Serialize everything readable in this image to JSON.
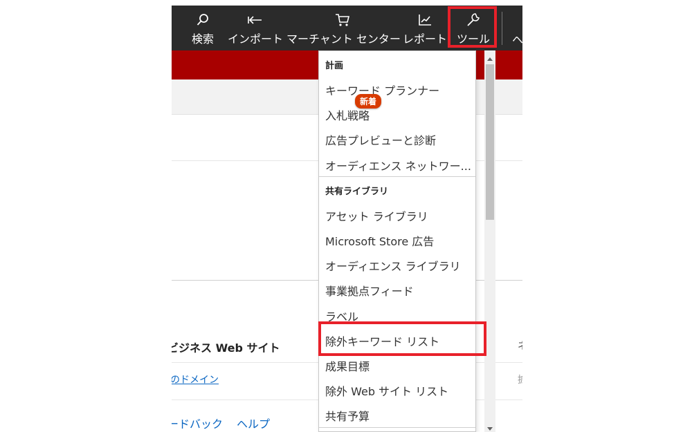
{
  "toolbar": {
    "items": [
      {
        "label": "検索",
        "icon": "search-icon"
      },
      {
        "label": "インポート",
        "icon": "import-arrow-icon"
      },
      {
        "label": "マーチャント センター",
        "icon": "cart-icon"
      },
      {
        "label": "レポート",
        "icon": "chart-icon"
      },
      {
        "label": "ツール",
        "icon": "wrench-icon"
      }
    ],
    "overflow": "ヘ"
  },
  "background": {
    "business_title": "ビジネス Web サイト",
    "domain_link": "のドメイン",
    "footer": [
      "ードバック",
      "ヘルプ"
    ],
    "right_fragment": "ネ",
    "right_fragment2": "拡"
  },
  "menu": {
    "sections": [
      {
        "title": "計画",
        "items": [
          "キーワード プランナー",
          "入札戦略",
          "広告プレビューと診断",
          "オーディエンス ネットワー..."
        ]
      },
      {
        "title": "共有ライブラリ",
        "items": [
          "アセット ライブラリ",
          "Microsoft Store 広告",
          "オーディエンス ライブラリ",
          "事業拠点フィード",
          "ラベル",
          "除外キーワード リスト",
          "成果目標",
          "除外 Web サイト リスト",
          "共有予算"
        ]
      }
    ],
    "badge": "新着"
  },
  "colors": {
    "toolbar_bg": "#2b2b2b",
    "brand_red": "#a80000",
    "highlight": "#e8212a",
    "badge": "#d83b01",
    "link": "#0a66c2"
  }
}
